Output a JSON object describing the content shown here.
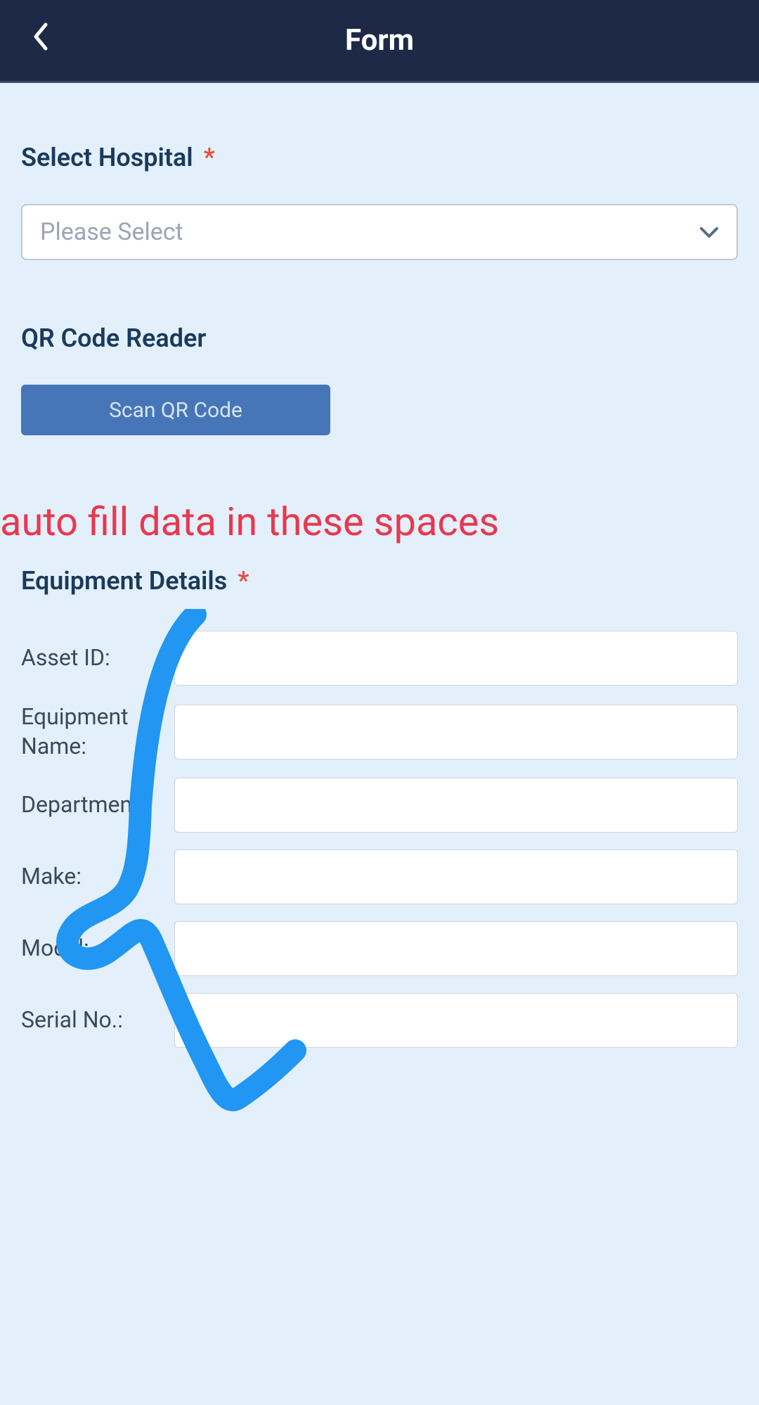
{
  "header": {
    "title": "Form"
  },
  "hospital": {
    "label": "Select Hospital",
    "placeholder": "Please Select"
  },
  "qr": {
    "label": "QR Code Reader",
    "button_label": "Scan QR Code"
  },
  "annotation": {
    "text": "auto fill data in these spaces"
  },
  "equipment": {
    "section_label": "Equipment Details",
    "fields": {
      "asset_id": {
        "label": "Asset ID:",
        "value": ""
      },
      "equipment_name": {
        "label": "Equipment Name:",
        "value": ""
      },
      "department": {
        "label": "Department:",
        "value": ""
      },
      "make": {
        "label": "Make:",
        "value": ""
      },
      "model": {
        "label": "Model:",
        "value": ""
      },
      "serial_no": {
        "label": "Serial No.:",
        "value": ""
      }
    }
  },
  "colors": {
    "header_bg": "#1e2947",
    "body_bg": "#e3f0fc",
    "label_text": "#1a3a5c",
    "annotation_text": "#e8384f",
    "annotation_stroke": "#2196f3",
    "button_bg": "#4676b8",
    "asterisk": "#e74c3c"
  }
}
